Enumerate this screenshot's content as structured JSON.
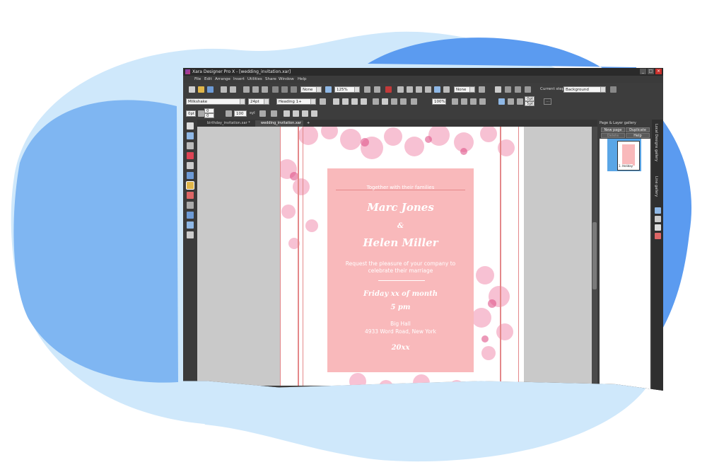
{
  "colors": {
    "blob_light": "#cfe8fb",
    "blob_mid": "#a9d3f6",
    "blob_dark": "#5b9bf0",
    "card_pink": "#f9b9bb",
    "flower_pink": "#f28fb0",
    "guide_red": "#e4888a",
    "selection_blue": "#5aa6e6"
  },
  "window": {
    "title": "Xara Designer Pro X - [wedding_invitation.xar]",
    "controls": [
      "_",
      "□",
      "×"
    ]
  },
  "menu": [
    "File",
    "Edit",
    "Arrange",
    "Insert",
    "Utilities",
    "Share",
    "Window",
    "Help"
  ],
  "toolbar1": {
    "quality_value": "None",
    "zoom_value": "125%",
    "feather_value": "None",
    "current_step_label": "Current step:",
    "current_step_value": "Background"
  },
  "toolbar2": {
    "font_value": "Milkshake",
    "size_value": "24pt",
    "style_value": "Heading 1+",
    "scale_value": "100%",
    "spacing_top": "0pt",
    "spacing_bottom": "5pt",
    "more_label": "..."
  },
  "toolbar3": {
    "indent_value": "0pt",
    "para_top": "0",
    "para_bottom": "0",
    "tracking_value": "100",
    "syl_label": "syl"
  },
  "tabs": [
    "birthday_invitation.xar *",
    "wedding_invitation.xar"
  ],
  "gallery": {
    "title": "Page & Layer gallery",
    "buttons": [
      "New page",
      "Duplicate",
      "Delete",
      "Help"
    ],
    "page_label": "1. Holiday",
    "side_tabs": [
      "Local Designs gallery",
      "Line gallery"
    ]
  },
  "invitation": {
    "intro": "Together with their families",
    "groom": "Marc Jones",
    "amp": "&",
    "bride": "Helen Miller",
    "request_line1": "Request the pleasure of your company to",
    "request_line2": "celebrate their marriage",
    "date": "Friday xx of month",
    "time": "5 pm",
    "venue": "Big Hall",
    "address": "4933 Word Road, New York",
    "year": "20xx"
  }
}
